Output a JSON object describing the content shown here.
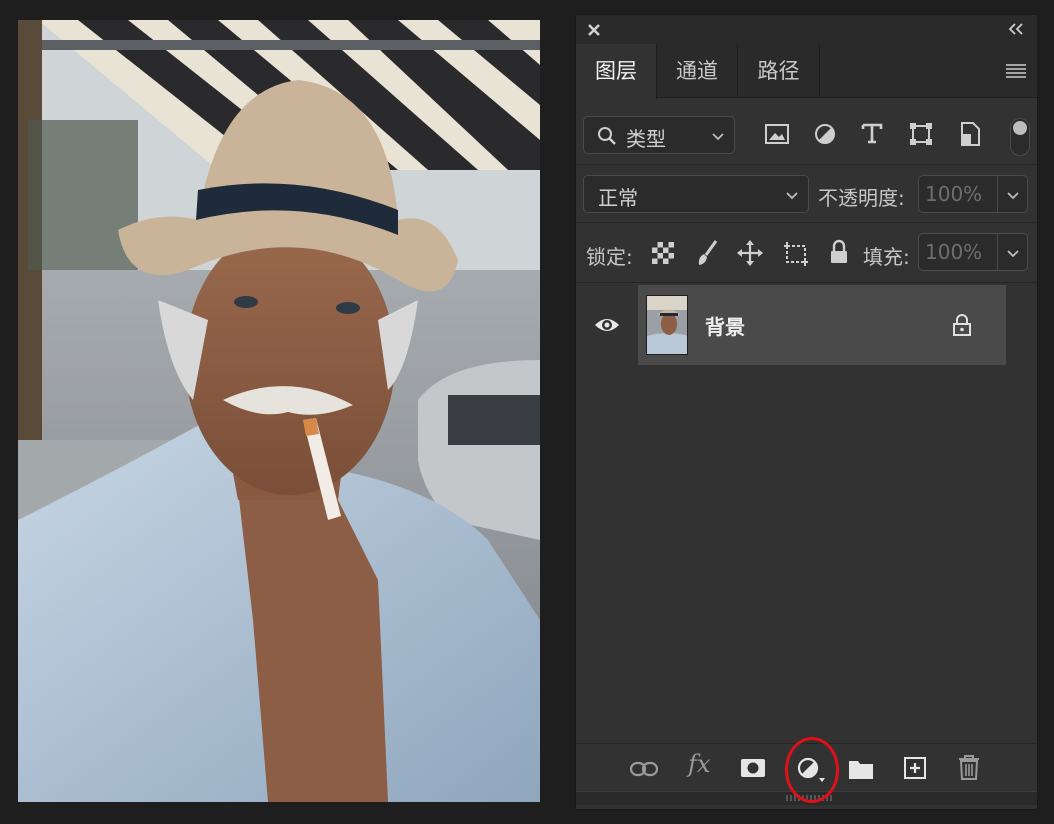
{
  "canvas": {
    "subject": "portrait-photo"
  },
  "panel": {
    "tabs": [
      {
        "label": "图层",
        "active": true
      },
      {
        "label": "通道",
        "active": false
      },
      {
        "label": "路径",
        "active": false
      }
    ],
    "filter": {
      "kind_label": "类型",
      "icons": [
        "image-filter-icon",
        "adjustment-filter-icon",
        "type-filter-icon",
        "shape-filter-icon",
        "smart-object-filter-icon"
      ]
    },
    "blend": {
      "mode": "正常",
      "opacity_label": "不透明度:",
      "opacity_value": "100%"
    },
    "lock": {
      "label": "锁定:",
      "icons": [
        "lock-transparent-icon",
        "lock-image-icon",
        "lock-position-icon",
        "lock-artboard-icon",
        "lock-all-icon"
      ],
      "fill_label": "填充:",
      "fill_value": "100%"
    },
    "layers": [
      {
        "name": "背景",
        "visible": true,
        "locked": true,
        "selected": true
      }
    ],
    "bottom_tools": [
      "link-layers-icon",
      "fx-icon",
      "add-mask-icon",
      "adjustment-layer-icon",
      "group-folder-icon",
      "new-layer-icon",
      "delete-icon"
    ],
    "fx_label": "fx"
  },
  "colors": {
    "panel_bg": "#323232",
    "selected_layer": "#4a4a4a",
    "highlight_ring": "#e0101a"
  }
}
